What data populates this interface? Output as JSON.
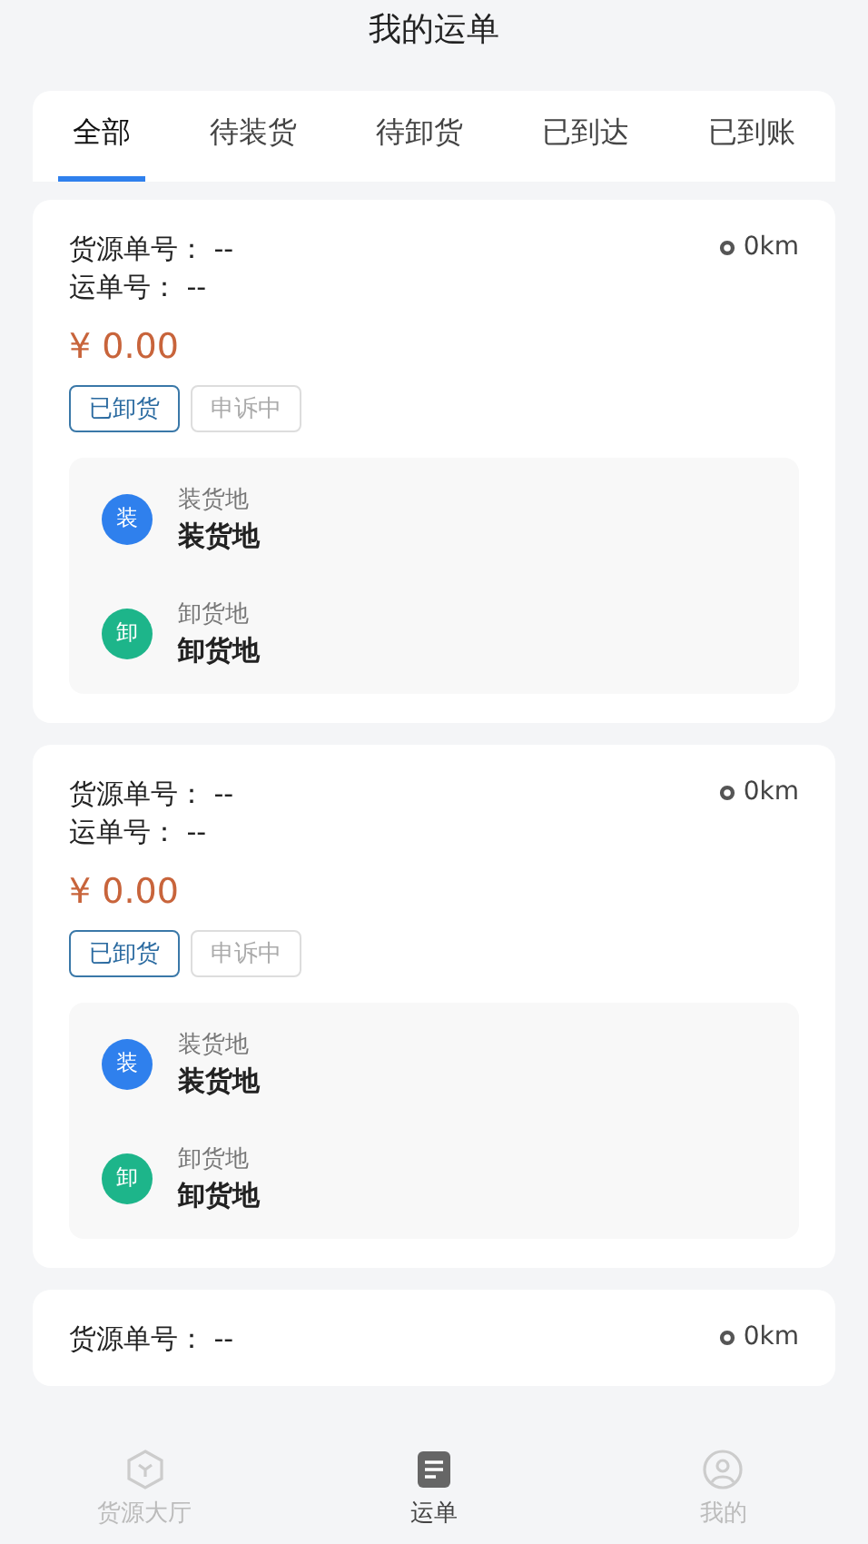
{
  "title": "我的运单",
  "tabs": [
    {
      "label": "全部",
      "selected": true
    },
    {
      "label": "待装货",
      "selected": false
    },
    {
      "label": "待卸货",
      "selected": false
    },
    {
      "label": "已到达",
      "selected": false
    },
    {
      "label": "已到账",
      "selected": false
    }
  ],
  "orders": [
    {
      "source_no_label": "货源单号：",
      "source_no": "--",
      "waybill_label": "运单号：",
      "waybill_no": "--",
      "distance": "0km",
      "price": "¥ 0.00",
      "tags": [
        {
          "label": "已卸货",
          "active": true
        },
        {
          "label": "申诉中",
          "active": false
        }
      ],
      "stops": [
        {
          "badge": "装",
          "color": "#2f80ed",
          "caption": "装货地",
          "place": "装货地"
        },
        {
          "badge": "卸",
          "color": "#1db58a",
          "caption": "卸货地",
          "place": "卸货地"
        }
      ]
    },
    {
      "source_no_label": "货源单号：",
      "source_no": "--",
      "waybill_label": "运单号：",
      "waybill_no": "--",
      "distance": "0km",
      "price": "¥ 0.00",
      "tags": [
        {
          "label": "已卸货",
          "active": true
        },
        {
          "label": "申诉中",
          "active": false
        }
      ],
      "stops": [
        {
          "badge": "装",
          "color": "#2f80ed",
          "caption": "装货地",
          "place": "装货地"
        },
        {
          "badge": "卸",
          "color": "#1db58a",
          "caption": "卸货地",
          "place": "卸货地"
        }
      ]
    },
    {
      "source_no_label": "货源单号：",
      "source_no": "--",
      "distance": "0km"
    }
  ],
  "nav": [
    {
      "label": "货源大厅",
      "selected": false
    },
    {
      "label": "运单",
      "selected": true
    },
    {
      "label": "我的",
      "selected": false
    }
  ]
}
